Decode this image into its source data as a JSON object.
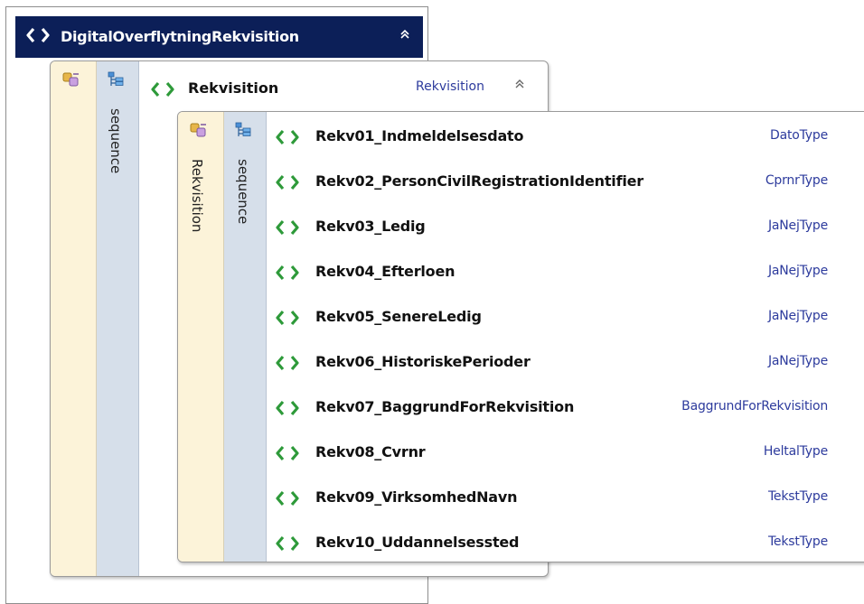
{
  "root": {
    "title": "DigitalOverflytningRekvisition",
    "collapse_glyph": "»"
  },
  "level2": {
    "sequence_label": "sequence",
    "element_name": "Rekvisition",
    "element_type": "Rekvisition",
    "collapse_glyph": "»"
  },
  "level3": {
    "complex_label": "Rekvisition",
    "sequence_label": "sequence",
    "rows": [
      {
        "name": "Rekv01_Indmeldelsesdato",
        "type": "DatoType"
      },
      {
        "name": "Rekv02_PersonCivilRegistrationIdentifier",
        "type": "CprnrType"
      },
      {
        "name": "Rekv03_Ledig",
        "type": "JaNejType"
      },
      {
        "name": "Rekv04_Efterloen",
        "type": "JaNejType"
      },
      {
        "name": "Rekv05_SenereLedig",
        "type": "JaNejType"
      },
      {
        "name": "Rekv06_HistoriskePerioder",
        "type": "JaNejType"
      },
      {
        "name": "Rekv07_BaggrundForRekvisition",
        "type": "BaggrundForRekvisition"
      },
      {
        "name": "Rekv08_Cvrnr",
        "type": "HeltalType"
      },
      {
        "name": "Rekv09_VirksomhedNavn",
        "type": "TekstType"
      },
      {
        "name": "Rekv10_Uddannelsessted",
        "type": "TekstType"
      }
    ]
  },
  "colors": {
    "header_bg": "#0c1f58",
    "element_icon": "#2e9a3a",
    "type_text": "#2d3b9d",
    "complex_strip": "#fcf3d9",
    "sequence_strip": "#d6dfea"
  },
  "icons": {
    "element": "element-icon",
    "complex_type": "complex-type-icon",
    "sequence": "sequence-icon",
    "collapse": "collapse-icon"
  }
}
